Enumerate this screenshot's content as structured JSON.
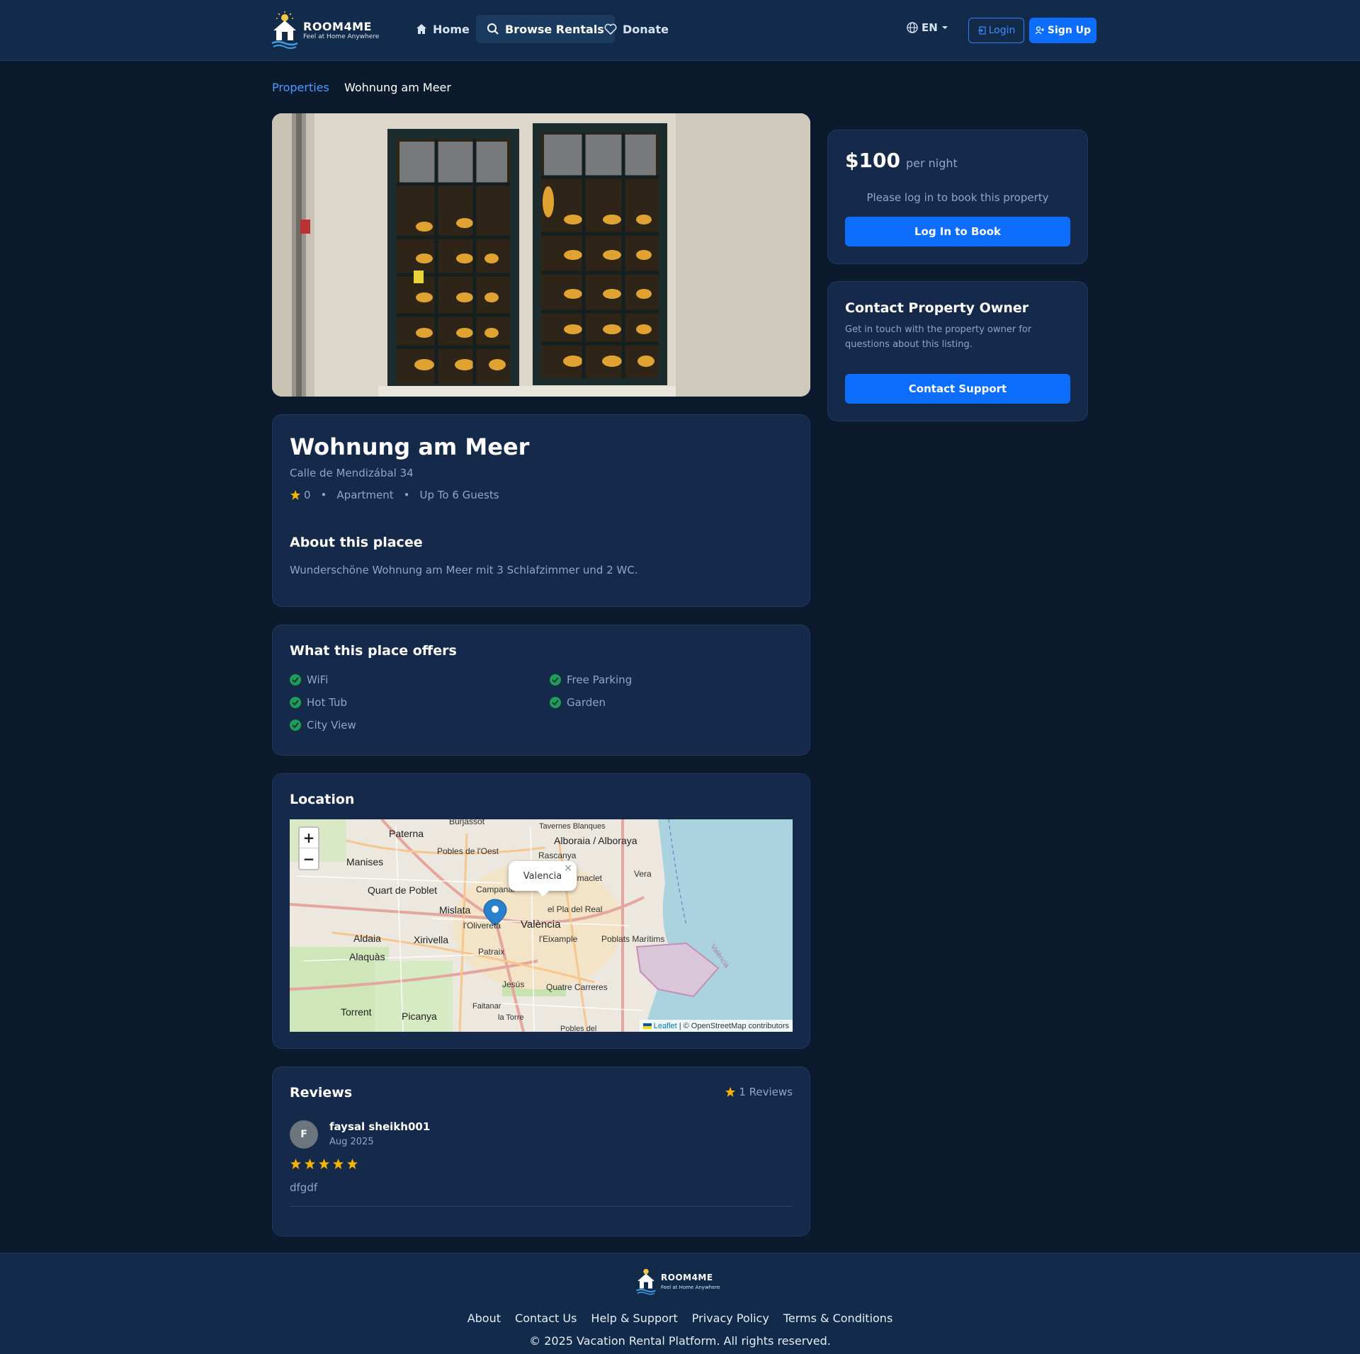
{
  "brand": {
    "name": "ROOM4ME",
    "tagline": "Feel at Home Anywhere"
  },
  "nav": {
    "home": "Home",
    "browse": "Browse Rentals",
    "donate": "Donate",
    "language": "EN",
    "login": "Login",
    "signup": "Sign Up"
  },
  "breadcrumb": {
    "parent": "Properties",
    "current": "Wohnung am Meer"
  },
  "property": {
    "title": "Wohnung am Meer",
    "address": "Calle de Mendizábal 34",
    "rating": "0",
    "type": "Apartment",
    "guests": "Up To 6 Guests",
    "about_title": "About this placee",
    "about_text": "Wunderschöne Wohnung am Meer mit 3 Schlafzimmer und 2 WC."
  },
  "amenities": {
    "title": "What this place offers",
    "items": [
      "WiFi",
      "Free Parking",
      "Hot Tub",
      "Garden",
      "City View"
    ]
  },
  "location": {
    "title": "Location",
    "popup": "Valencia",
    "zoom_in": "+",
    "zoom_out": "−",
    "attribution_leaflet": "Leaflet",
    "attribution_rest": "| © OpenStreetMap contributors",
    "labels": {
      "burjassot": "Burjassot",
      "tavernes": "Tavernes Blanques",
      "paterna": "Paterna",
      "alboraia": "Alboraia / Alboraya",
      "pobles_oest": "Pobles de l'Oest",
      "rascanya": "Rascanya",
      "manises": "Manises",
      "vera": "Vera",
      "quart": "Quart de Poblet",
      "campanar": "Campanar",
      "algiros": "imaclet",
      "pla_real": "el Pla del Real",
      "mislata": "Mislata",
      "olivereta": "l'Olivereta",
      "valencia": "València",
      "eixample": "l'Eixample",
      "poblats": "Poblats Marítims",
      "aldaia": "Aldaia",
      "xirivella": "Xirivella",
      "alaquas": "Alaquàs",
      "patraix": "Patraix",
      "jesus": "Jesús",
      "quatre": "Quatre Carreres",
      "torrent": "Torrent",
      "picanya": "Picanya",
      "faitanar": "Faitanar",
      "la_torre": "la Torre",
      "pobles_del": "Pobles del",
      "valencia_port": "València"
    }
  },
  "reviews": {
    "title": "Reviews",
    "count": "1 Reviews",
    "items": [
      {
        "initial": "F",
        "user": "faysal sheikh001",
        "date": "Aug 2025",
        "stars": 5,
        "text": "dfgdf"
      }
    ]
  },
  "booking": {
    "price": "$100",
    "unit": "per night",
    "note": "Please log in to book this property",
    "button": "Log In to Book"
  },
  "contact": {
    "title": "Contact Property Owner",
    "text": "Get in touch with the property owner for questions about this listing.",
    "button": "Contact Support"
  },
  "footer": {
    "links": [
      "About",
      "Contact Us",
      "Help & Support",
      "Privacy Policy",
      "Terms & Conditions"
    ],
    "copyright": "© 2025 Vacation Rental Platform. All rights reserved."
  },
  "colors": {
    "accent": "#0d6efd",
    "background": "#0b1a2c",
    "card": "#15294a",
    "star": "#f5b301",
    "check": "#1f9d55"
  }
}
